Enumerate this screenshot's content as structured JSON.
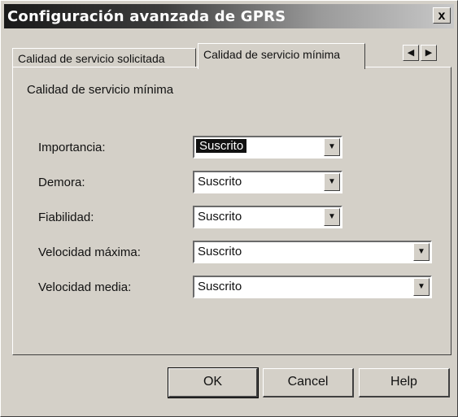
{
  "window": {
    "title": "Configuración avanzada de GPRS",
    "close_label": "x"
  },
  "tabs": [
    {
      "label": "Calidad de servicio solicitada"
    },
    {
      "label": "Calidad de servicio mínima"
    }
  ],
  "panel": {
    "title": "Calidad de servicio mínima",
    "fields": [
      {
        "label": "Importancia:",
        "value": "Suscrito"
      },
      {
        "label": "Demora:",
        "value": "Suscrito"
      },
      {
        "label": "Fiabilidad:",
        "value": "Suscrito"
      },
      {
        "label": "Velocidad máxima:",
        "value": "Suscrito"
      },
      {
        "label": "Velocidad media:",
        "value": "Suscrito"
      }
    ]
  },
  "buttons": {
    "ok": "OK",
    "cancel": "Cancel",
    "help": "Help"
  },
  "icons": {
    "tab_scroll_left": "arrow-left-icon",
    "tab_scroll_right": "arrow-right-icon",
    "dropdown": "chevron-down-icon"
  }
}
